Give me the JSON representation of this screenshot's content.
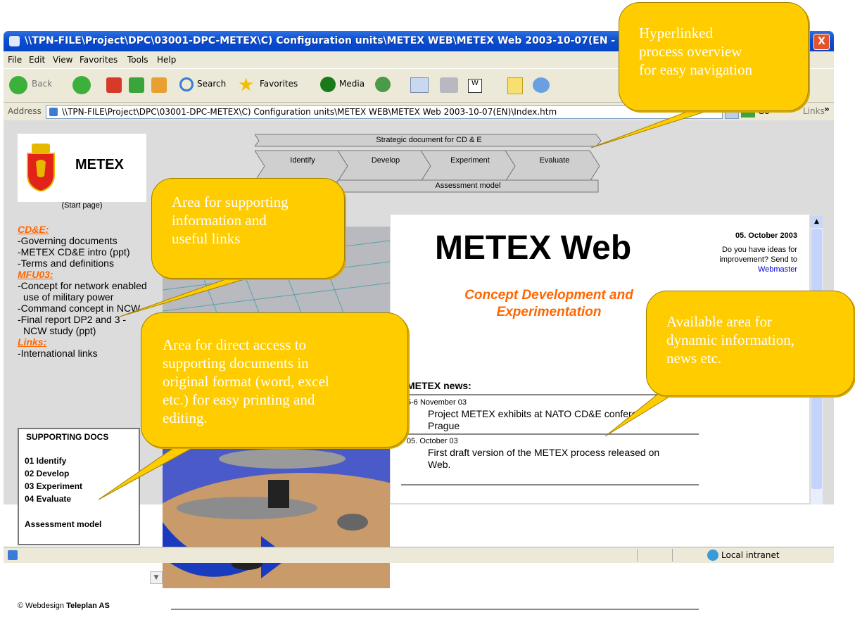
{
  "window": {
    "title": "\\\\TPN-FILE\\Project\\DPC\\03001-DPC-METEX\\C) Configuration units\\METEX WEB\\METEX Web 2003-10-07(EN - Microsoft In",
    "close": "X"
  },
  "menu": [
    "File",
    "Edit",
    "View",
    "Favorites",
    "Tools",
    "Help"
  ],
  "toolbar": {
    "back": "Back",
    "search": "Search",
    "favorites": "Favorites",
    "media": "Media"
  },
  "address": {
    "label": "Address",
    "value": "\\\\TPN-FILE\\Project\\DPC\\03001-DPC-METEX\\C) Configuration units\\METEX WEB\\METEX Web 2003-10-07(EN)\\Index.htm",
    "go": "Go",
    "links": "Links",
    "chevron": "»"
  },
  "logo": {
    "text": "METEX",
    "start": "(Start page)"
  },
  "process": {
    "strategic": "Strategic document for CD & E",
    "steps": [
      "Identify",
      "Develop",
      "Experiment",
      "Evaluate"
    ],
    "assessment": "Assessment model"
  },
  "leftnav": {
    "h1": "CD&E:",
    "items1": [
      "-Governing documents",
      "-METEX CD&E intro (ppt)",
      "-Terms and definitions"
    ],
    "h2": "MFU03:",
    "items2": [
      "-Concept for network enabled",
      "use of military power",
      "-Command concept in NCW",
      "-Final report DP2 and 3 -",
      "NCW study (ppt)"
    ],
    "h3": "Links:",
    "items3": [
      "-International links"
    ]
  },
  "docs": {
    "title": "SUPPORTING DOCS",
    "items": [
      "01 Identify",
      "02 Develop",
      "03 Experiment",
      "04 Evaluate"
    ],
    "assessment": "Assessment model"
  },
  "copyright": {
    "prefix": "© Webdesign ",
    "company": "Teleplan AS"
  },
  "content": {
    "title": "METEX Web",
    "subtitle1": "Concept Development and",
    "subtitle2": "Experimentation",
    "date": "05. October 2003",
    "ideas1": "Do you have ideas for",
    "ideas2": "improvement? Send to",
    "webmaster": "Webmaster",
    "news_heading": "METEX news:",
    "news": [
      {
        "date": "5-6 November 03",
        "text1": "Project METEX exhibits at NATO CD&E confere",
        "text2": "Prague"
      },
      {
        "date": "05. October 03",
        "text1": "First draft version of the METEX process released on",
        "text2": "Web."
      }
    ]
  },
  "status": {
    "zone": "Local intranet"
  },
  "callouts": {
    "c1": [
      "Hyperlinked",
      "process overview",
      "for easy navigation"
    ],
    "c2": [
      "Area for supporting",
      "information and",
      "useful links"
    ],
    "c3": [
      "Area for direct access to",
      "supporting documents in",
      "original format (word, excel",
      "etc.) for easy printing and",
      "editing."
    ],
    "c4": [
      "Available area for",
      "dynamic information,",
      "news etc."
    ]
  },
  "colors": {
    "accent": "#ff6600",
    "callout": "#ffcc00",
    "titlebar": "#0a4fd2"
  }
}
